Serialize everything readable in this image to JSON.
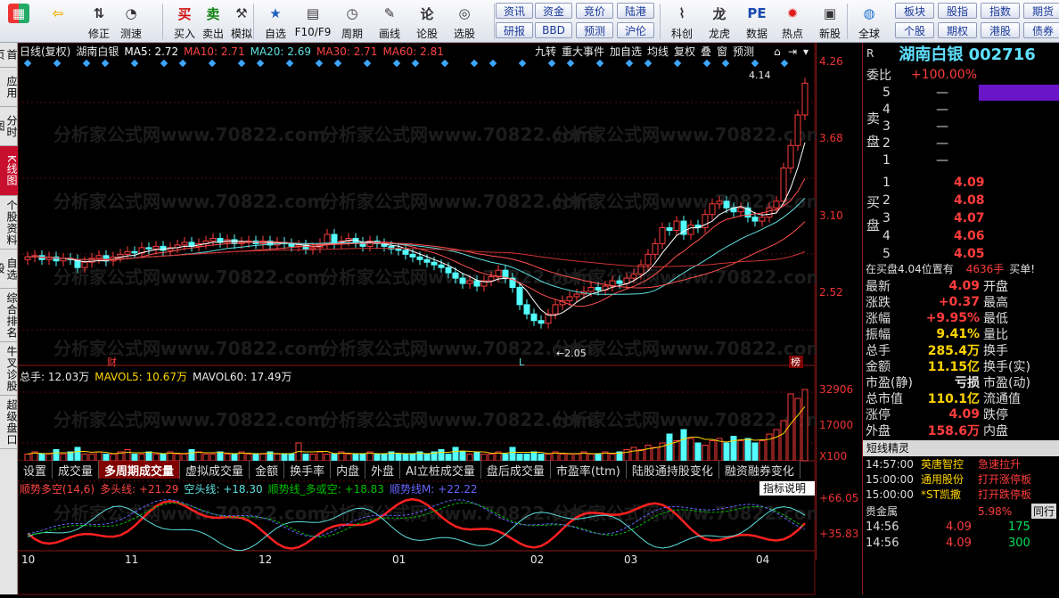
{
  "toolbar": {
    "items": [
      {
        "label": "",
        "icon": "app-grid-icon"
      },
      {
        "label": "",
        "icon": "back-arrow-icon"
      },
      {
        "label": "修正",
        "icon": "up-down-icon"
      },
      {
        "label": "测速",
        "icon": "speed-icon"
      },
      {
        "label": "买入",
        "icon": "buy-icon",
        "glyph": "买"
      },
      {
        "label": "卖出",
        "icon": "sell-icon",
        "glyph": "卖"
      },
      {
        "label": "模拟",
        "icon": "hammer-icon"
      },
      {
        "label": "自选",
        "icon": "star-icon"
      },
      {
        "label": "F10/F9",
        "icon": "doc-icon"
      },
      {
        "label": "周期",
        "icon": "clock-icon"
      },
      {
        "label": "画线",
        "icon": "pen-icon"
      },
      {
        "label": "论股",
        "icon": "discuss-icon"
      },
      {
        "label": "选股",
        "icon": "select-icon"
      },
      {
        "label": "科创",
        "icon": "chart-icon"
      },
      {
        "label": "龙虎",
        "icon": "dragon-icon"
      },
      {
        "label": "数据",
        "icon": "pe-icon",
        "glyph": "PE"
      },
      {
        "label": "热点",
        "icon": "hot-icon"
      },
      {
        "label": "新股",
        "icon": "new-icon"
      },
      {
        "label": "全球",
        "icon": "globe-icon"
      }
    ],
    "quick": [
      "资讯",
      "资金",
      "竞价",
      "陆港",
      "研报",
      "BBD",
      "预测",
      "沪伦",
      "板块",
      "股指",
      "指数",
      "期货",
      "个股",
      "期权",
      "港股",
      "债券",
      "股市"
    ]
  },
  "leftbar": [
    "首页",
    "应用",
    "分时图",
    "K线图",
    "个股资料",
    "自选股",
    "综合排名",
    "牛叉诊股",
    "超级盘口"
  ],
  "chart": {
    "header_left": "日线(复权)",
    "stock": "湖南白银",
    "ma": [
      {
        "label": "MA5: 2.72",
        "color": "#ffffff"
      },
      {
        "label": "MA10: 2.71",
        "color": "#ff4444"
      },
      {
        "label": "MA20: 2.69",
        "color": "#5ee0e0"
      },
      {
        "label": "MA30: 2.71",
        "color": "#ff4444"
      },
      {
        "label": "MA60: 2.81",
        "color": "#ff4444"
      }
    ],
    "header_btns": [
      "九转",
      "重大事件",
      "加自选",
      "均线",
      "复权",
      "叠",
      "窗",
      "预测"
    ],
    "price_axis": [
      "4.26",
      "3.68",
      "3.10",
      "2.52"
    ],
    "high_label": "4.14",
    "low_label": "2.05",
    "markers": [
      "财",
      "L",
      "榜"
    ],
    "vol_header": [
      {
        "label": "总手: 12.03万",
        "color": "#e8e8e8"
      },
      {
        "label": "MAVOL5: 10.67万",
        "color": "#ffd400"
      },
      {
        "label": "MAVOL60: 17.49万",
        "color": "#e8e8e8"
      }
    ],
    "vol_axis": [
      "32906",
      "17000",
      "X100"
    ],
    "tabs": [
      "设置",
      "成交量",
      "多周期成交量",
      "虚拟成交量",
      "金额",
      "换手率",
      "内盘",
      "外盘",
      "AI立桩成交量",
      "盘后成交量",
      "市盈率(ttm)",
      "陆股通持股变化",
      "融资融券变化"
    ],
    "active_tab": "多周期成交量",
    "ind_header": [
      {
        "label": "顺势多空(14,6)",
        "color": "#ff4444"
      },
      {
        "label": "多头线: +21.29",
        "color": "#ff4444"
      },
      {
        "label": "空头线: +18.30",
        "color": "#5ee0e0"
      },
      {
        "label": "顺势线_多或空: +18.83",
        "color": "#00c000"
      },
      {
        "label": "顺势线M: +22.22",
        "color": "#6666ff"
      }
    ],
    "ind_btn": "指标说明",
    "ind_axis": [
      "+66.05",
      "+35.83"
    ],
    "months": [
      "10",
      "11",
      "12",
      "01",
      "02",
      "03",
      "04"
    ],
    "watermark": "分析家公式网www.70822.com"
  },
  "candles": [
    2.78,
    2.79,
    2.76,
    2.78,
    2.75,
    2.77,
    2.76,
    2.7,
    2.74,
    2.77,
    2.79,
    2.75,
    2.78,
    2.8,
    2.82,
    2.81,
    2.85,
    2.84,
    2.86,
    2.83,
    2.85,
    2.87,
    2.89,
    2.86,
    2.88,
    2.9,
    2.92,
    2.89,
    2.91,
    2.88,
    2.89,
    2.9,
    2.88,
    2.9,
    2.87,
    2.89,
    2.88,
    2.86,
    2.87,
    2.84,
    2.85,
    2.88,
    2.95,
    2.88,
    2.9,
    2.92,
    2.89,
    2.86,
    2.9,
    2.88,
    2.86,
    2.84,
    2.83,
    2.8,
    2.78,
    2.76,
    2.74,
    2.72,
    2.7,
    2.66,
    2.62,
    2.58,
    2.6,
    2.56,
    2.6,
    2.63,
    2.68,
    2.62,
    2.55,
    2.42,
    2.35,
    2.3,
    2.28,
    2.35,
    2.42,
    2.45,
    2.48,
    2.5,
    2.52,
    2.55,
    2.53,
    2.56,
    2.6,
    2.58,
    2.62,
    2.65,
    2.72,
    2.8,
    2.88,
    3.0,
    2.98,
    3.05,
    2.95,
    3.02,
    3.0,
    3.1,
    3.18,
    3.2,
    3.15,
    3.12,
    3.15,
    3.08,
    3.05,
    3.08,
    3.15,
    3.2,
    3.45,
    3.62,
    3.85,
    4.09
  ],
  "volumes": [
    3,
    4,
    3,
    3,
    5,
    3,
    4,
    6,
    3,
    3,
    4,
    3,
    3,
    4,
    5,
    3,
    3,
    4,
    3,
    3,
    4,
    3,
    3,
    5,
    4,
    3,
    3,
    4,
    3,
    3,
    4,
    3,
    3,
    3,
    4,
    3,
    3,
    3,
    8,
    3,
    3,
    4,
    3,
    3,
    4,
    3,
    3,
    3,
    4,
    3,
    3,
    4,
    3,
    3,
    3,
    4,
    3,
    4,
    5,
    3,
    6,
    4,
    3,
    4,
    3,
    3,
    4,
    3,
    6,
    3,
    3,
    4,
    3,
    3,
    4,
    3,
    3,
    3,
    4,
    3,
    3,
    4,
    3,
    4,
    5,
    6,
    5,
    7,
    6,
    8,
    12,
    9,
    14,
    10,
    8,
    7,
    9,
    10,
    8,
    11,
    9,
    10,
    8,
    9,
    12,
    14,
    18,
    30,
    28,
    32
  ],
  "right": {
    "title": "湖南白银 002716",
    "r_tag": "R",
    "weibi_label": "委比",
    "weibi": "+100.00%",
    "sell_label": "卖盘",
    "buy_label": "买盘",
    "sell": [
      [
        "5",
        "—"
      ],
      [
        "4",
        "—"
      ],
      [
        "3",
        "—"
      ],
      [
        "2",
        "—"
      ],
      [
        "1",
        "—"
      ]
    ],
    "buy": [
      [
        "1",
        "4.09"
      ],
      [
        "2",
        "4.08"
      ],
      [
        "3",
        "4.07"
      ],
      [
        "4",
        "4.06"
      ],
      [
        "5",
        "4.05"
      ]
    ],
    "seal": "在买盘4.04位置有",
    "seal_vol": "4636手",
    "seal_tail": "买单!",
    "quote": [
      {
        "l": "最新",
        "v": "4.09",
        "c": "red",
        "l2": "开盘",
        "v2": ""
      },
      {
        "l": "涨跌",
        "v": "+0.37",
        "c": "red",
        "l2": "最高",
        "v2": ""
      },
      {
        "l": "涨幅",
        "v": "+9.95%",
        "c": "red",
        "l2": "最低",
        "v2": ""
      },
      {
        "l": "振幅",
        "v": "9.41%",
        "c": "yel",
        "l2": "量比",
        "v2": ""
      },
      {
        "l": "总手",
        "v": "285.4万",
        "c": "yel",
        "l2": "换手",
        "v2": ""
      },
      {
        "l": "金额",
        "v": "11.15亿",
        "c": "yel",
        "l2": "换手(实)",
        "v2": ""
      },
      {
        "l": "市盈(静)",
        "v": "亏损",
        "c": "wht",
        "l2": "市盈(动)",
        "v2": ""
      },
      {
        "l": "总市值",
        "v": "110.1亿",
        "c": "yel",
        "l2": "流通值",
        "v2": ""
      },
      {
        "l": "涨停",
        "v": "4.09",
        "c": "red",
        "l2": "跌停",
        "v2": ""
      },
      {
        "l": "外盘",
        "v": "158.6万",
        "c": "red",
        "l2": "内盘",
        "v2": ""
      }
    ],
    "spirit": "短线精灵",
    "news": [
      [
        "14:57:00",
        "英唐智控",
        "急速拉升"
      ],
      [
        "15:00:00",
        "通用股份",
        "打开涨停板"
      ],
      [
        "15:00:00",
        "*ST凯撒",
        "打开跌停板"
      ]
    ],
    "sector": "贵金属",
    "sector_pct": "5.98%",
    "sector_tab": "同行",
    "ticks": [
      [
        "14:56",
        "4.09",
        "175"
      ],
      [
        "14:56",
        "4.09",
        "300"
      ]
    ]
  }
}
